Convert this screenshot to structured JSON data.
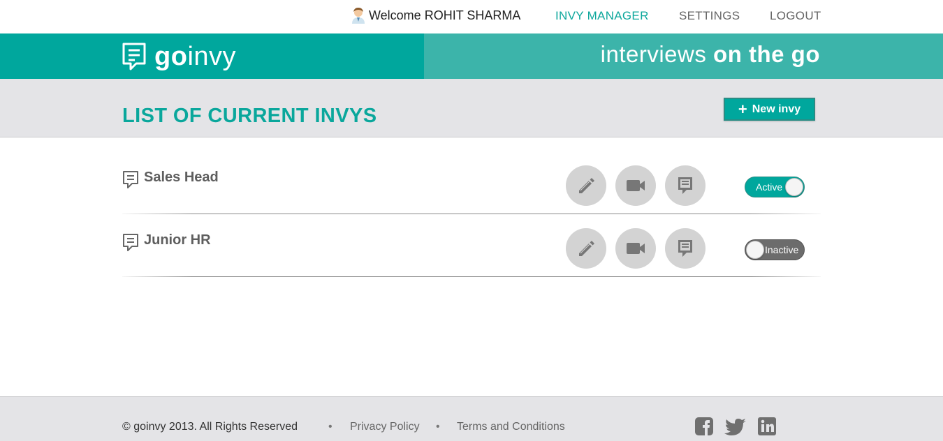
{
  "header": {
    "welcome_text": "Welcome ROHIT SHARMA",
    "nav": {
      "invy_manager": "INVY MANAGER",
      "settings": "SETTINGS",
      "logout": "LOGOUT"
    }
  },
  "banner": {
    "logo_bold": "go",
    "logo_light": "invy",
    "tagline_light": "interviews ",
    "tagline_bold": "on the go"
  },
  "main": {
    "title": "LIST OF CURRENT INVYS",
    "new_button_label": "New invy",
    "invys": [
      {
        "title": "Sales Head",
        "status": "Active",
        "active": true
      },
      {
        "title": "Junior HR",
        "status": "Inactive",
        "active": false
      }
    ]
  },
  "footer": {
    "copyright": "© goinvy 2013. All Rights Reserved",
    "separator": "•",
    "privacy": "Privacy Policy",
    "terms": "Terms and Conditions",
    "social": [
      "facebook-icon",
      "twitter-icon",
      "linkedin-icon"
    ]
  },
  "colors": {
    "brand": "#00a79d",
    "brand_light": "#3cb4aa",
    "band": "#e4e4e7",
    "action_circle": "#d3d3d3",
    "inactive_toggle": "#6c6c6c"
  }
}
